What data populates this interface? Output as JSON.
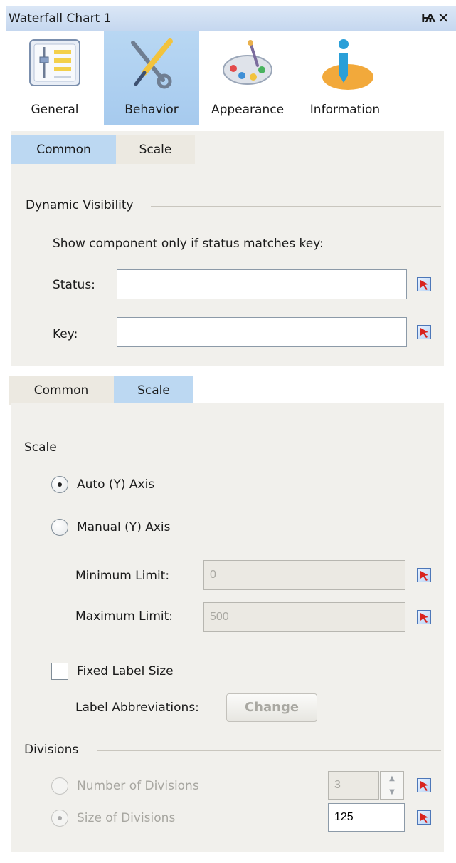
{
  "window": {
    "title": "Waterfall Chart 1",
    "pin_glyph": "Ѩ",
    "close_glyph": "✕"
  },
  "toolstrip": {
    "tabs": [
      {
        "label": "General",
        "icon": "sliders-icon",
        "active": false
      },
      {
        "label": "Behavior",
        "icon": "tools-icon",
        "active": true
      },
      {
        "label": "Appearance",
        "icon": "palette-icon",
        "active": false
      },
      {
        "label": "Information",
        "icon": "info-icon",
        "active": false
      }
    ]
  },
  "panel1": {
    "subtabs": [
      {
        "label": "Common",
        "active": true
      },
      {
        "label": "Scale",
        "active": false
      }
    ],
    "section_title": "Dynamic Visibility",
    "instruction": "Show component only if status matches key:",
    "status_label": "Status:",
    "status_value": "",
    "key_label": "Key:",
    "key_value": ""
  },
  "panel2": {
    "subtabs": [
      {
        "label": "Common",
        "active": false
      },
      {
        "label": "Scale",
        "active": true
      }
    ],
    "scale_title": "Scale",
    "auto_axis_label": "Auto (Y) Axis",
    "auto_axis_selected": true,
    "manual_axis_label": "Manual (Y) Axis",
    "manual_axis_selected": false,
    "min_limit_label": "Minimum Limit:",
    "min_limit_value": "0",
    "max_limit_label": "Maximum Limit:",
    "max_limit_value": "500",
    "fixed_label_size_label": "Fixed Label Size",
    "fixed_label_size_checked": false,
    "label_abbrev_label": "Label Abbreviations:",
    "change_button": "Change",
    "divisions_title": "Divisions",
    "num_divisions_label": "Number of Divisions",
    "num_divisions_value": "3",
    "size_divisions_label": "Size of Divisions",
    "size_divisions_value": "125"
  },
  "colors": {
    "titlebar": "#c5d7ef",
    "active_tab": "#a6caee",
    "panel_bg": "#f1f0ec",
    "bind_icon": "#d9231e"
  }
}
